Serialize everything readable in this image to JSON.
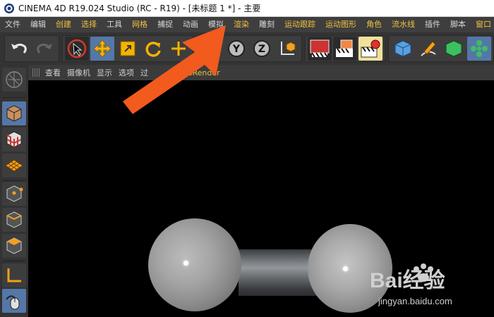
{
  "window": {
    "title": "CINEMA 4D R19.024 Studio (RC - R19) - [未标题 1 *] - 主要"
  },
  "menubar": {
    "items": [
      {
        "label": "文件",
        "highlight": false
      },
      {
        "label": "编辑",
        "highlight": false
      },
      {
        "label": "创建",
        "highlight": true
      },
      {
        "label": "选择",
        "highlight": true
      },
      {
        "label": "工具",
        "highlight": false
      },
      {
        "label": "网格",
        "highlight": true
      },
      {
        "label": "捕捉",
        "highlight": false
      },
      {
        "label": "动画",
        "highlight": false
      },
      {
        "label": "模拟",
        "highlight": false
      },
      {
        "label": "渲染",
        "highlight": true
      },
      {
        "label": "雕刻",
        "highlight": false
      },
      {
        "label": "运动跟踪",
        "highlight": true
      },
      {
        "label": "运动图形",
        "highlight": true
      },
      {
        "label": "角色",
        "highlight": true
      },
      {
        "label": "流水线",
        "highlight": true
      },
      {
        "label": "插件",
        "highlight": false
      },
      {
        "label": "脚本",
        "highlight": false
      },
      {
        "label": "窗口",
        "highlight": true
      }
    ]
  },
  "toolbar": {
    "icons": {
      "undo": "undo-icon",
      "redo": "redo-icon",
      "select": "live-selection-icon",
      "move": "move-icon",
      "scale": "scale-icon",
      "rotate": "rotate-icon",
      "x_axis": "X",
      "y_axis": "Y",
      "z_axis": "Z"
    }
  },
  "viewport": {
    "menus": [
      {
        "label": "查看",
        "highlight": false
      },
      {
        "label": "摄像机",
        "highlight": false
      },
      {
        "label": "显示",
        "highlight": false
      },
      {
        "label": "选项",
        "highlight": false
      },
      {
        "label": "过",
        "highlight": false
      },
      {
        "label": "ProRender",
        "highlight": true
      }
    ]
  },
  "watermark": {
    "logo_text": "Bai经验",
    "url": "jingyan.baidu.com"
  },
  "colors": {
    "menu_highlight": "#f0c040",
    "selected_tool": "#5577a8",
    "arrow": "#f25a1e"
  }
}
